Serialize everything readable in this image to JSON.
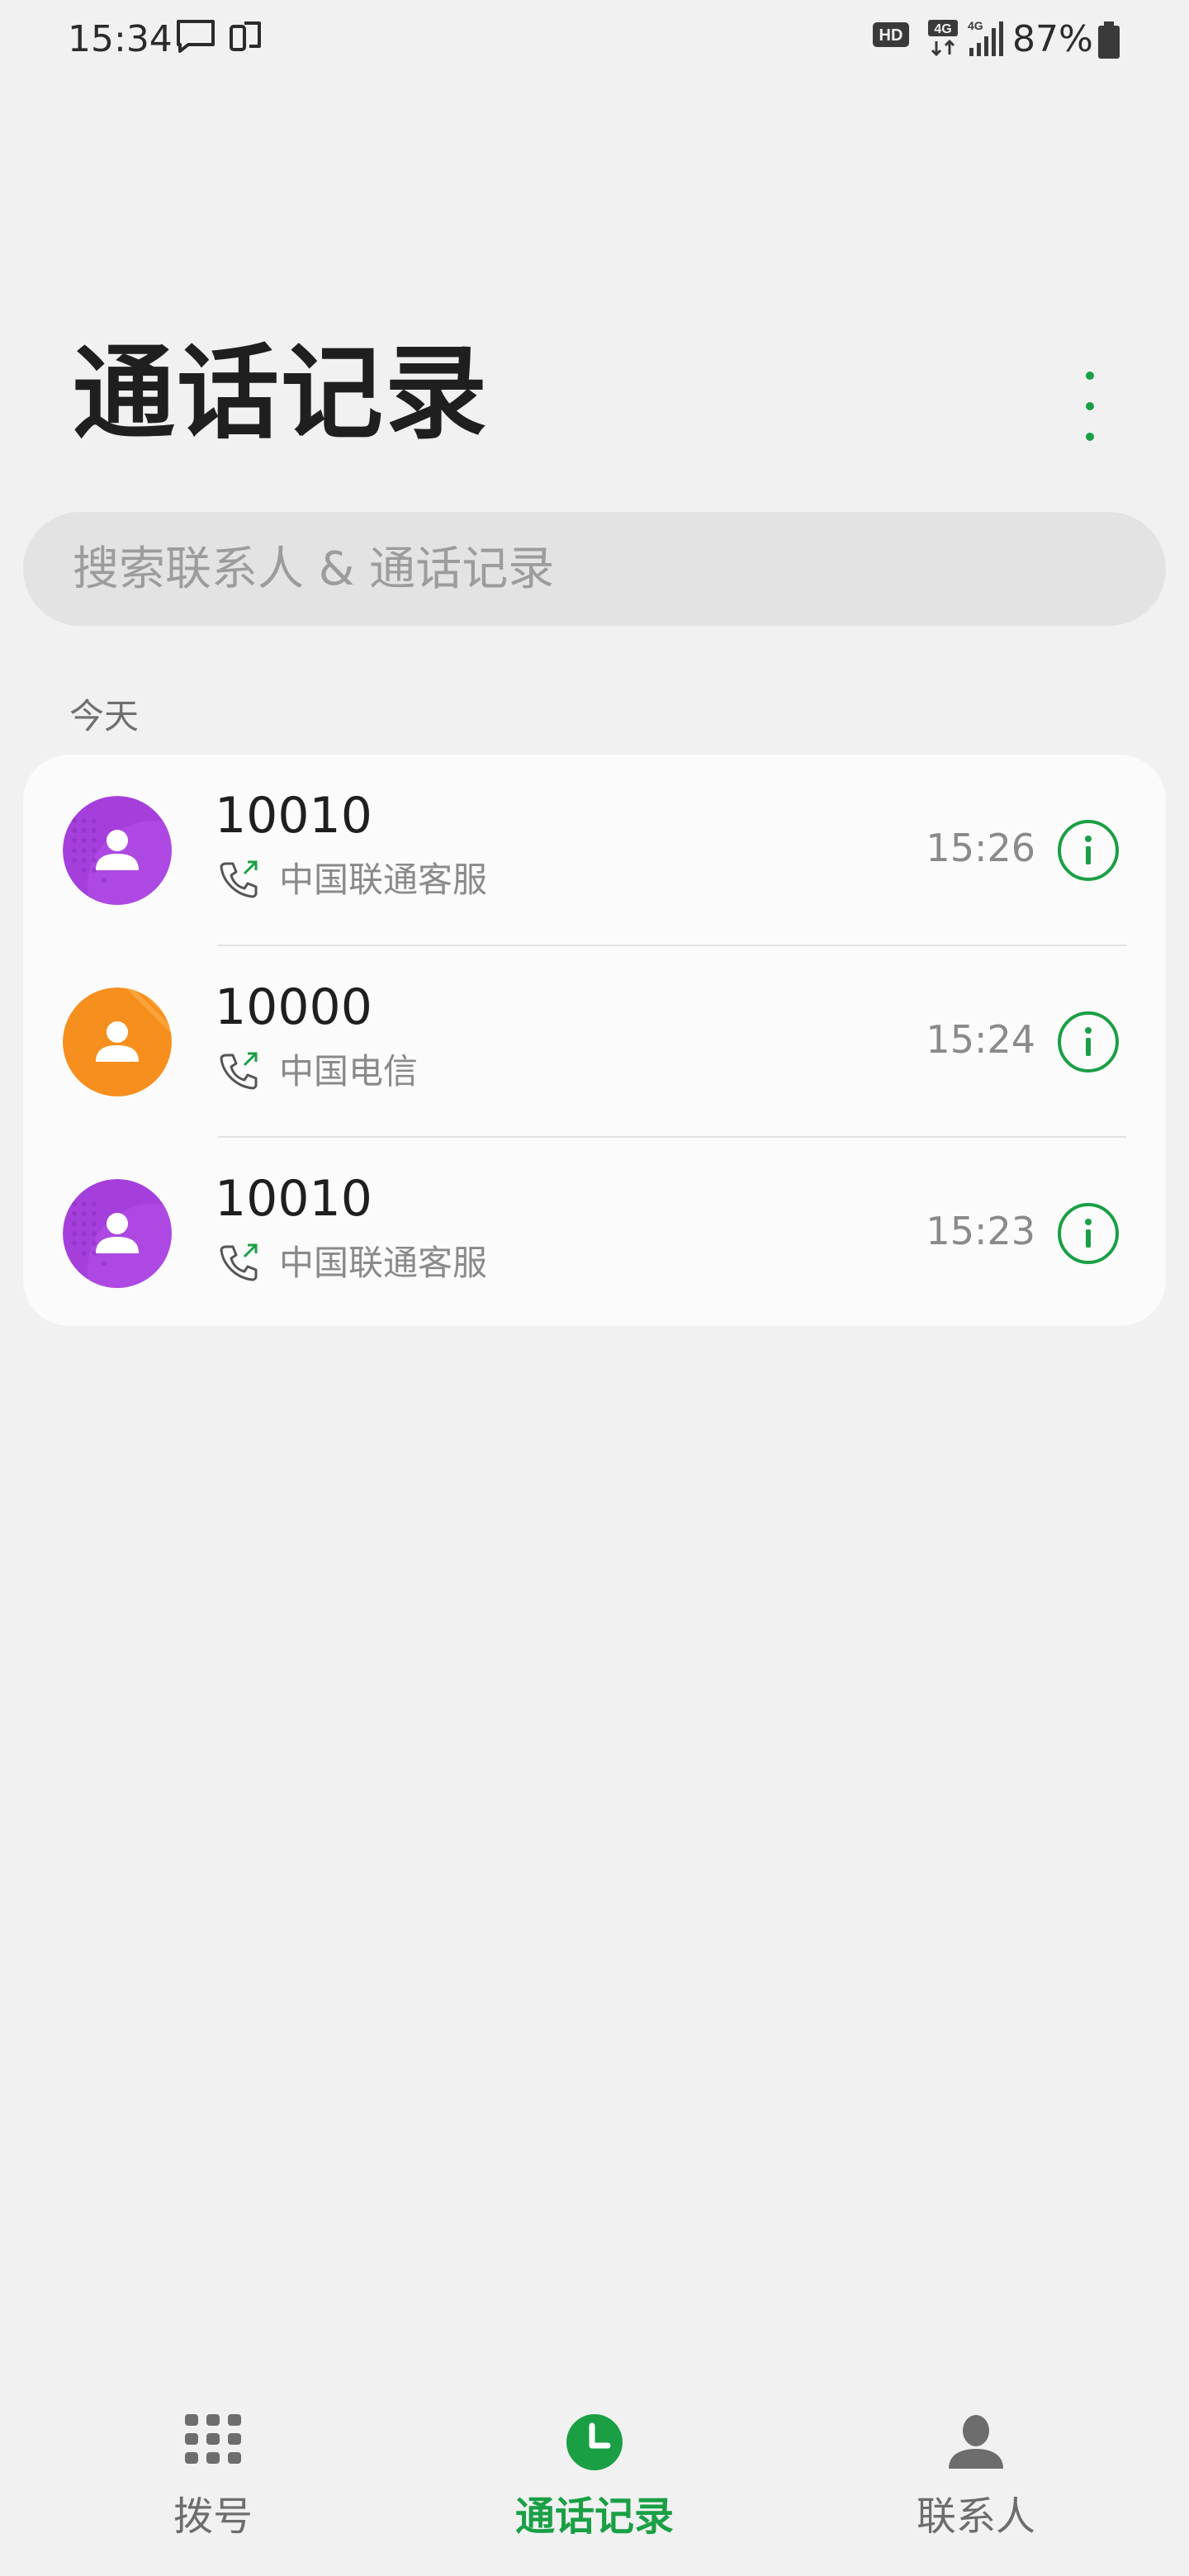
{
  "status_bar": {
    "time": "15:34",
    "battery": "87%",
    "icons": [
      "message-icon",
      "dual-screen-icon",
      "hd-icon",
      "4g-data-icon",
      "4g-signal-icon",
      "battery-icon"
    ]
  },
  "header": {
    "title": "通话记录",
    "more_icon": "more-vertical-icon"
  },
  "search": {
    "placeholder": "搜索联系人 & 通话记录"
  },
  "section": {
    "label": "今天"
  },
  "calls": [
    {
      "number": "10010",
      "label": "中国联通客服",
      "time": "15:26",
      "avatar_color": "#a53fdc",
      "type_icon": "outgoing-call-icon"
    },
    {
      "number": "10000",
      "label": "中国电信",
      "time": "15:24",
      "avatar_color": "#f78f1e",
      "type_icon": "outgoing-call-icon"
    },
    {
      "number": "10010",
      "label": "中国联通客服",
      "time": "15:23",
      "avatar_color": "#a53fdc",
      "type_icon": "outgoing-call-icon"
    }
  ],
  "bottom_nav": {
    "items": [
      {
        "label": "拨号",
        "icon": "dialpad-icon",
        "active": false
      },
      {
        "label": "通话记录",
        "icon": "clock-icon",
        "active": true
      },
      {
        "label": "联系人",
        "icon": "person-icon",
        "active": false
      }
    ]
  },
  "colors": {
    "accent": "#1a9f45",
    "background": "#f1f1f1",
    "card": "#fbfbfb",
    "search_bg": "#e3e3e3"
  }
}
